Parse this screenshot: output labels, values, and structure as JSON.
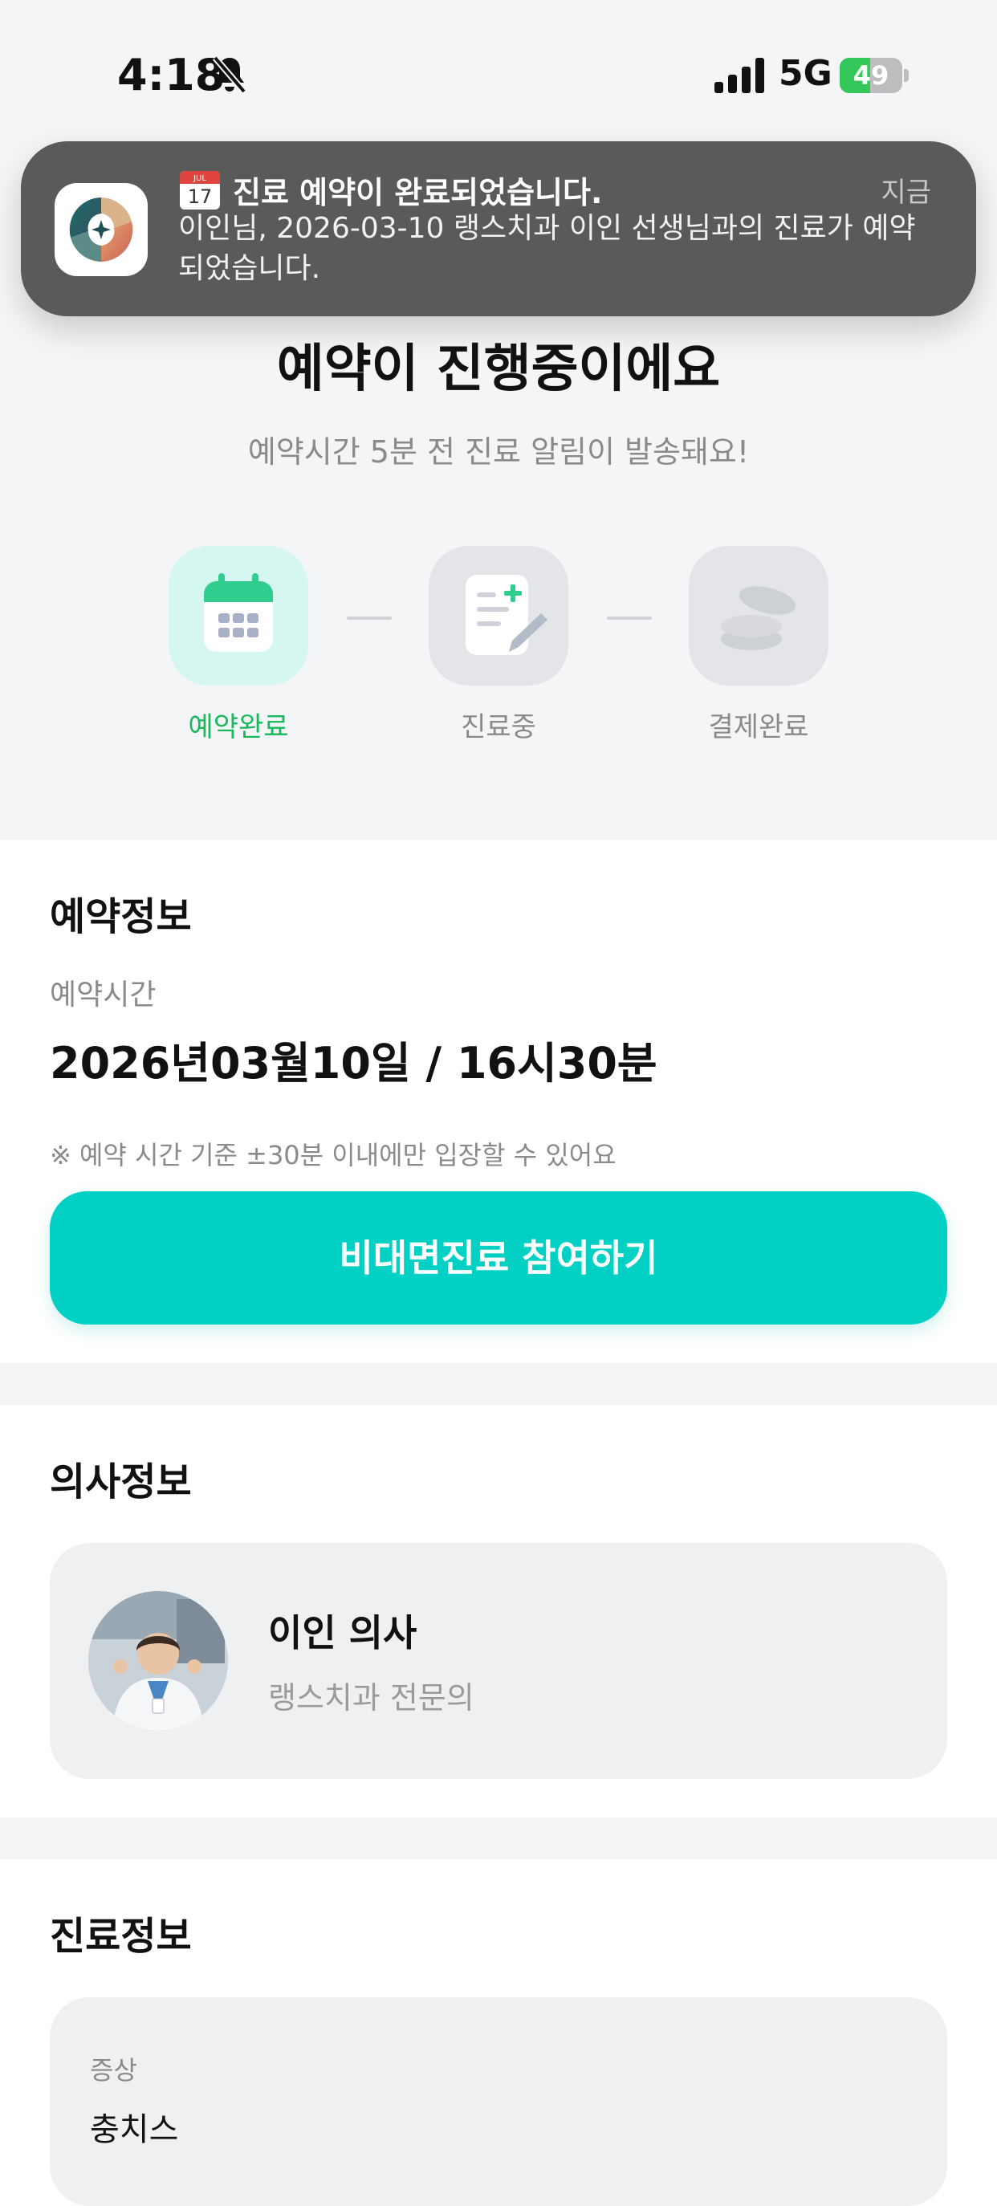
{
  "status_bar": {
    "time": "4:18",
    "network": "5G",
    "battery": 49,
    "battery_label": "49"
  },
  "notification": {
    "title": "진료 예약이 완료되었습니다.",
    "time": "지금",
    "body": "이인님, 2026-03-10 랭스치과 이인 선생님과의 진료가 예약되었습니다.",
    "calendar_day": "17",
    "calendar_month": "JUL"
  },
  "hero": {
    "title": "예약이 진행중이에요",
    "subtitle": "예약시간 5분 전 진료 알림이 발송돼요!"
  },
  "steps": [
    {
      "label": "예약완료",
      "icon": "calendar-icon",
      "active": true
    },
    {
      "label": "진료중",
      "icon": "medical-note-icon",
      "active": false
    },
    {
      "label": "결제완료",
      "icon": "coins-icon",
      "active": false
    }
  ],
  "reservation": {
    "section_title": "예약정보",
    "time_label": "예약시간",
    "time_value": "2026년03월10일 / 16시30분",
    "note": "※ 예약 시간 기준 ±30분 이내에만 입장할 수 있어요",
    "join_button": "비대면진료 참여하기"
  },
  "doctor": {
    "section_title": "의사정보",
    "name": "이인 의사",
    "specialty": "랭스치과 전문의"
  },
  "treatment": {
    "section_title": "진료정보",
    "symptom_label": "증상",
    "symptom_value": "충치스"
  },
  "colors": {
    "accent": "#00d1c4",
    "step_active_text": "#1ab85c",
    "step_active_bg": "#d6f6f1",
    "page_bg": "#f4f5f7"
  }
}
